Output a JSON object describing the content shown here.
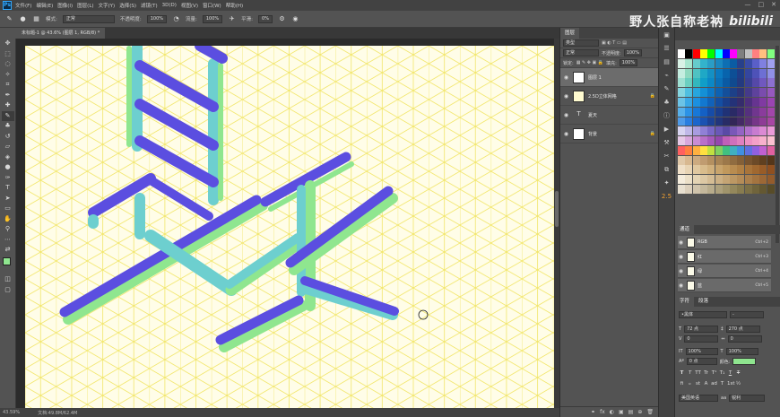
{
  "menubar": {
    "items": [
      "文件(F)",
      "编辑(E)",
      "图像(I)",
      "图层(L)",
      "文字(Y)",
      "选择(S)",
      "滤镜(T)",
      "3D(D)",
      "视图(V)",
      "窗口(W)",
      "帮助(H)"
    ],
    "window_controls": [
      "—",
      "□",
      "✕"
    ]
  },
  "options": {
    "mode_label": "模式:",
    "mode_value": "正常",
    "opacity_label": "不透明度:",
    "opacity_value": "100%",
    "flow_label": "流量:",
    "flow_value": "100%",
    "smoothing_label": "平滑:",
    "smoothing_value": "0%"
  },
  "watermark": {
    "text": "野人张自称老衲",
    "logo": "bilibili"
  },
  "document": {
    "tab_title": "未标题-1 @ 43.6% (图层 1, RGB/8) *",
    "zoom": "43.59%",
    "doc_info": "文档:49.8M/62.4M"
  },
  "layers_panel": {
    "tab": "图层",
    "kind_filter": "类型",
    "blend_mode": "正常",
    "opacity_label": "不透明度:",
    "opacity_value": "100%",
    "lock_label": "锁定:",
    "fill_label": "填充:",
    "fill_value": "100%",
    "layers": [
      {
        "name": "图层 1",
        "thumb": "",
        "selected": true,
        "locked": false
      },
      {
        "name": "2.5D立体网格",
        "thumb": "",
        "selected": false,
        "locked": true
      },
      {
        "name": "夏天",
        "thumb": "T",
        "selected": false,
        "locked": false
      },
      {
        "name": "背景",
        "thumb": "",
        "selected": false,
        "locked": true
      }
    ],
    "footer_icons": [
      "fx",
      "◐",
      "▣",
      "▤",
      "⊕",
      "🗑"
    ]
  },
  "swatches": {
    "colors": [
      "#ffffff",
      "#000000",
      "#ff0000",
      "#ffff00",
      "#00ff00",
      "#00ffff",
      "#0000ff",
      "#ff00ff",
      "#7f7f7f",
      "#c0c0c0",
      "#ff8080",
      "#ffc080",
      "#80ff80",
      "#d9f2e6",
      "#a8e6cf",
      "#66cccc",
      "#33b3cc",
      "#2a9dc6",
      "#1a87c0",
      "#0e6fb3",
      "#0a5ca3",
      "#27408b",
      "#3a4ca8",
      "#5a5fc8",
      "#8080e0",
      "#a0a0f0",
      "#c4ede0",
      "#8fd9c0",
      "#4fc2c2",
      "#1fa8c6",
      "#1490c4",
      "#0a79c0",
      "#0864ad",
      "#0d4f96",
      "#1e3d88",
      "#34469f",
      "#4e52b8",
      "#6d6fd4",
      "#9090e6",
      "#9fe0d2",
      "#6bcfc0",
      "#33b8bd",
      "#109ec8",
      "#0b88c6",
      "#0a70b8",
      "#0a5aa3",
      "#104a8f",
      "#233a80",
      "#3a4094",
      "#5548a8",
      "#7058bf",
      "#8c70d0",
      "#86d6e0",
      "#4fbfe0",
      "#27a6de",
      "#1490d6",
      "#0d79c8",
      "#0e62b2",
      "#144f9a",
      "#1d4088",
      "#2c3478",
      "#453a8a",
      "#5e429c",
      "#7a4cae",
      "#9658bf",
      "#6cc3e6",
      "#3aa8e6",
      "#1c90e0",
      "#1278d0",
      "#1162ba",
      "#144ea2",
      "#1a3e8a",
      "#243278",
      "#352c6c",
      "#4d2f7e",
      "#663490",
      "#803aa2",
      "#9a44b2",
      "#58b0ea",
      "#2c92e6",
      "#1878d8",
      "#1460c4",
      "#164ca8",
      "#1a3e8e",
      "#203276",
      "#2a2a66",
      "#3c2a70",
      "#55307e",
      "#70368e",
      "#8a3c9c",
      "#a246aa",
      "#4f9be8",
      "#2a7ee0",
      "#1a66cc",
      "#1a52b2",
      "#1c4296",
      "#22367c",
      "#282c66",
      "#322658",
      "#442a66",
      "#5c3076",
      "#763688",
      "#8e3c96",
      "#a846a4",
      "#d8d4f0",
      "#c0b8e8",
      "#a89ce0",
      "#9080d6",
      "#7a68c8",
      "#6a58b8",
      "#5a4aa6",
      "#7a58b8",
      "#9464c4",
      "#b070cc",
      "#c87cd0",
      "#dc8ad4",
      "#ec9ad8",
      "#e6c8e6",
      "#d8a8dc",
      "#c88cd4",
      "#b870c8",
      "#a65abc",
      "#9448ae",
      "#c060b8",
      "#d070bc",
      "#e080c0",
      "#ee90c4",
      "#f4a0c8",
      "#f8b0cc",
      "#fcc0d0",
      "#ff6060",
      "#ff8040",
      "#ffb040",
      "#ffe040",
      "#c0e040",
      "#80d060",
      "#40c080",
      "#40b0c0",
      "#4090e0",
      "#6070e0",
      "#9060e0",
      "#c060d0",
      "#e060a0",
      "#e0c8a8",
      "#d8b890",
      "#ccaa80",
      "#c09c70",
      "#b49060",
      "#a88454",
      "#9c784a",
      "#906c40",
      "#846038",
      "#785430",
      "#6c4a28",
      "#604020",
      "#54361a",
      "#f0e0c8",
      "#e8d4b4",
      "#e0c8a0",
      "#d8bc8c",
      "#d0b07c",
      "#c8a46c",
      "#c0985c",
      "#b88c50",
      "#b08044",
      "#a8743a",
      "#a06830",
      "#985c28",
      "#905020",
      "#f4ecdc",
      "#ece0c8",
      "#e4d4b4",
      "#dcc8a4",
      "#d4bc94",
      "#ccb084",
      "#c4a474",
      "#bc9864",
      "#b48c58",
      "#ac804c",
      "#a47440",
      "#9c6836",
      "#945c2c",
      "#e8e0d0",
      "#dcd0bc",
      "#d0c4ac",
      "#c4b89c",
      "#b8ac8c",
      "#aca07c",
      "#a0946c",
      "#94885c",
      "#887c50",
      "#7c7046",
      "#70643c",
      "#645832",
      "#584c28"
    ]
  },
  "channels": {
    "tabs": [
      "通道"
    ],
    "items": [
      {
        "name": "RGB",
        "key": "Ctrl+2"
      },
      {
        "name": "红",
        "key": "Ctrl+3"
      },
      {
        "name": "绿",
        "key": "Ctrl+4"
      },
      {
        "name": "蓝",
        "key": "Ctrl+5"
      }
    ]
  },
  "character": {
    "tabs": [
      "字符",
      "段落"
    ],
    "font_family": "•黑体",
    "font_style": "-",
    "font_size": "72 点",
    "leading": "270 点",
    "kerning": "0",
    "tracking": "0",
    "vscale": "100%",
    "hscale": "100%",
    "baseline": "0 点",
    "color_label": "颜色:",
    "color": "#8fe58f",
    "style_buttons": [
      "T",
      "T",
      "TT",
      "Tr",
      "T¹",
      "T₁",
      "T",
      "T"
    ],
    "language": "美国英语",
    "antialias": "锐利"
  },
  "artwork": {
    "purple": "#5b4ee0",
    "teal": "#6dcfcf",
    "green": "#8fe68f",
    "grid": "#f2e66a",
    "grid_faint": "#9ad8c8",
    "background": "#fffde8"
  }
}
